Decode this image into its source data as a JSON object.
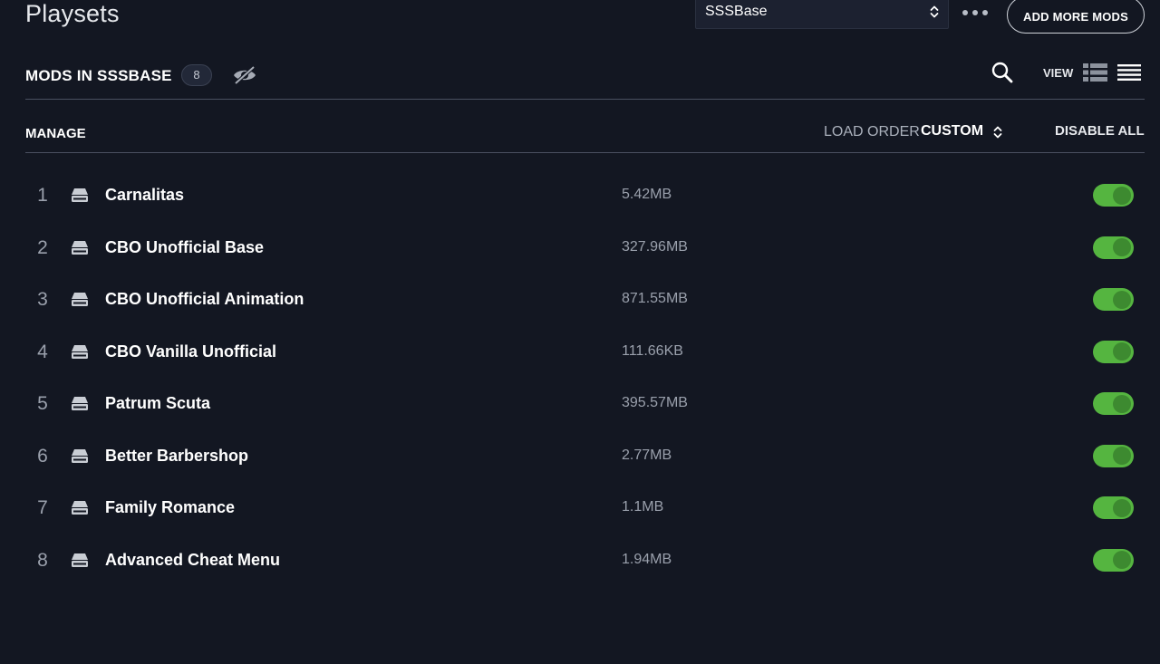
{
  "header": {
    "title": "Playsets",
    "playset_select": {
      "value": "SSSBase"
    },
    "more_label": "•••",
    "add_mods_label": "ADD MORE MODS"
  },
  "mods_header": {
    "title": "MODS IN SSSBASE",
    "count": "8",
    "view_label": "VIEW"
  },
  "manage_bar": {
    "manage_label": "MANAGE",
    "load_order_label": "LOAD ORDER",
    "load_order_value": "CUSTOM",
    "disable_all_label": "DISABLE ALL"
  },
  "mods": [
    {
      "index": "1",
      "name": "Carnalitas",
      "size": "5.42MB",
      "enabled": true
    },
    {
      "index": "2",
      "name": "CBO Unofficial Base",
      "size": "327.96MB",
      "enabled": true
    },
    {
      "index": "3",
      "name": "CBO Unofficial Animation",
      "size": "871.55MB",
      "enabled": true
    },
    {
      "index": "4",
      "name": "CBO Vanilla Unofficial",
      "size": "111.66KB",
      "enabled": true
    },
    {
      "index": "5",
      "name": "Patrum Scuta",
      "size": "395.57MB",
      "enabled": true
    },
    {
      "index": "6",
      "name": "Better Barbershop",
      "size": "2.77MB",
      "enabled": true
    },
    {
      "index": "7",
      "name": "Family Romance",
      "size": "1.1MB",
      "enabled": true
    },
    {
      "index": "8",
      "name": "Advanced Cheat Menu",
      "size": "1.94MB",
      "enabled": true
    }
  ],
  "colors": {
    "background": "#131722",
    "toggle_on": "#55b540",
    "toggle_knob": "#3d8a30",
    "muted_text": "#9aa0ac"
  },
  "icons": {
    "playset_arrows": "chevron-up-down-icon",
    "hide": "eye-slash-icon",
    "search": "search-icon",
    "view_detail": "list-detail-icon",
    "view_compact": "list-compact-icon",
    "mod_source": "drive-icon"
  }
}
